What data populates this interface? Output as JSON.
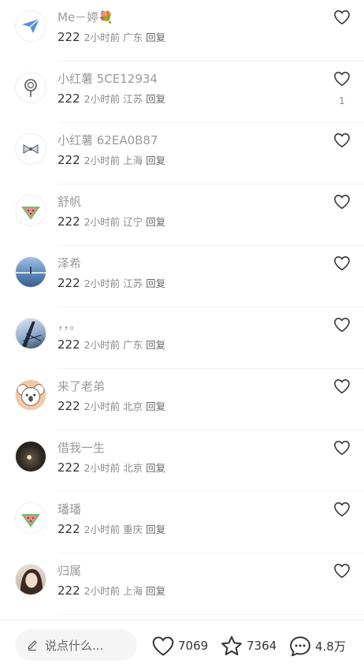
{
  "comments": [
    {
      "username": "Me－婷💐",
      "text": "222",
      "time": "2小时前",
      "location": "广东",
      "reply": "回复",
      "likes": "",
      "avatar": "paper-plane-avatar"
    },
    {
      "username": "小红薯 5CE12934",
      "text": "222",
      "time": "2小时前",
      "location": "江苏",
      "reply": "回复",
      "likes": "1",
      "avatar": "lollipop-avatar"
    },
    {
      "username": "小红薯 62EA0B87",
      "text": "222",
      "time": "2小时前",
      "location": "上海",
      "reply": "回复",
      "likes": "",
      "avatar": "bow-avatar"
    },
    {
      "username": "舒帆",
      "text": "222",
      "time": "2小时前",
      "location": "辽宁",
      "reply": "回复",
      "likes": "",
      "avatar": "watermelon-avatar"
    },
    {
      "username": "泽希",
      "text": "222",
      "time": "2小时前",
      "location": "江苏",
      "reply": "回复",
      "likes": "",
      "avatar": "sea-photo-avatar"
    },
    {
      "username": "，，。",
      "text": "222",
      "time": "2小时前",
      "location": "广东",
      "reply": "回复",
      "likes": "",
      "avatar": "tower-photo-avatar"
    },
    {
      "username": "来了老弟",
      "text": "222",
      "time": "2小时前",
      "location": "北京",
      "reply": "回复",
      "likes": "",
      "avatar": "koala-avatar"
    },
    {
      "username": "借我一生",
      "text": "222",
      "time": "2小时前",
      "location": "北京",
      "reply": "回复",
      "likes": "",
      "avatar": "dark-photo-avatar"
    },
    {
      "username": "璠璠",
      "text": "222",
      "time": "2小时前",
      "location": "重庆",
      "reply": "回复",
      "likes": "",
      "avatar": "watermelon-avatar"
    },
    {
      "username": "归属",
      "text": "222",
      "time": "2小时前",
      "location": "上海",
      "reply": "回复",
      "likes": "",
      "avatar": "portrait-photo-avatar"
    }
  ],
  "bottom_bar": {
    "input_placeholder": "说点什么...",
    "likes_count": "7069",
    "collects_count": "7364",
    "comments_count": "4.8万"
  },
  "icons": {
    "like": "heart-outline-icon",
    "collect": "star-outline-icon",
    "comment": "chat-bubble-icon",
    "input": "pencil-icon"
  },
  "colors": {
    "username": "#9a9a9a",
    "body_text": "#333333",
    "meta": "#8a8a8a",
    "input_bg": "#f5f5f5"
  }
}
